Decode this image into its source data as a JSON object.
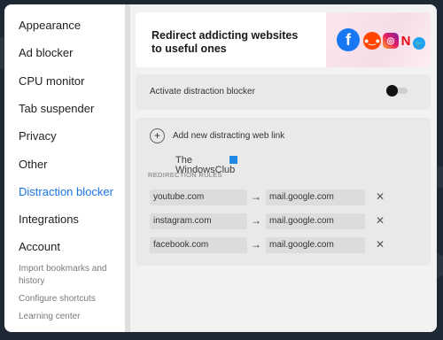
{
  "sidebar": {
    "items": [
      {
        "label": "Appearance"
      },
      {
        "label": "Ad blocker"
      },
      {
        "label": "CPU monitor"
      },
      {
        "label": "Tab suspender"
      },
      {
        "label": "Privacy"
      },
      {
        "label": "Other"
      },
      {
        "label": "Distraction blocker",
        "active": true
      },
      {
        "label": "Integrations"
      },
      {
        "label": "Account"
      }
    ],
    "links": [
      {
        "label": "Import bookmarks and history"
      },
      {
        "label": "Configure shortcuts"
      },
      {
        "label": "Learning center"
      }
    ]
  },
  "banner": {
    "title": "Redirect addicting websites to useful ones",
    "icons": [
      "facebook-icon",
      "reddit-icon",
      "instagram-icon",
      "netflix-icon",
      "twitter-icon"
    ]
  },
  "activate": {
    "label": "Activate distraction blocker",
    "enabled": false
  },
  "add_link": {
    "label": "Add new distracting web link"
  },
  "rules": {
    "title": "REDIRECTION RULES",
    "items": [
      {
        "from": "youtube.com",
        "to": "mail.google.com"
      },
      {
        "from": "instagram.com",
        "to": "mail.google.com"
      },
      {
        "from": "facebook.com",
        "to": "mail.google.com"
      }
    ]
  },
  "watermark": {
    "line1": "The",
    "line2": "WindowsClub"
  },
  "colors": {
    "accent": "#1a73e8",
    "facebook": "#1877f2",
    "reddit": "#ff4500",
    "netflix": "#e50914",
    "twitter": "#1da1f2"
  }
}
